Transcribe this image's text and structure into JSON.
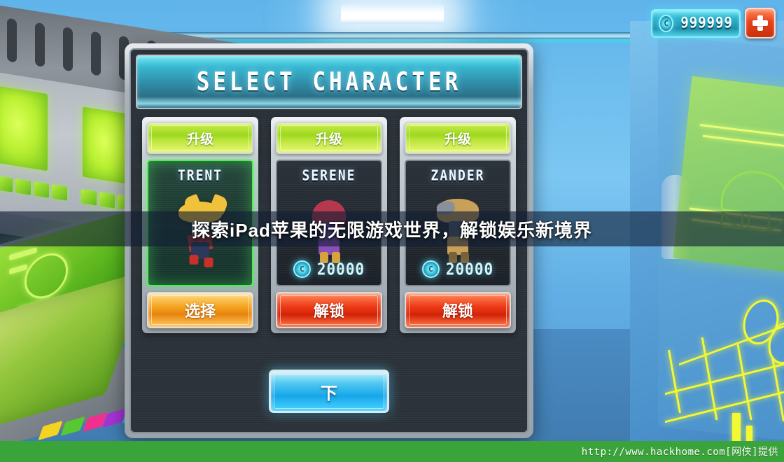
{
  "hud": {
    "currency_value": "999999",
    "coin_glyph": "C",
    "add_label": "+"
  },
  "panel": {
    "title": "SELECT CHARACTER",
    "next_label": "下"
  },
  "cards": [
    {
      "upgrade_label": "升级",
      "name": "TRENT",
      "price": "",
      "coin_glyph": "C",
      "action_label": "选择",
      "state": "owned"
    },
    {
      "upgrade_label": "升级",
      "name": "SERENE",
      "price": "20000",
      "coin_glyph": "C",
      "action_label": "解锁",
      "state": "locked"
    },
    {
      "upgrade_label": "升级",
      "name": "ZANDER",
      "price": "20000",
      "coin_glyph": "C",
      "action_label": "解锁",
      "state": "locked"
    }
  ],
  "overlay": {
    "headline": "探索iPad苹果的无限游戏世界，解锁娱乐新境界"
  },
  "footer": {
    "watermark": "http://www.hackhome.com[网侠]提供"
  },
  "colors": {
    "accent_cyan": "#35c6e6",
    "green_button": "#9ed820",
    "orange_button": "#f5a623",
    "red_button": "#ef3d19",
    "footer_green": "#3aa43a",
    "panel_dark": "#2b3138"
  }
}
